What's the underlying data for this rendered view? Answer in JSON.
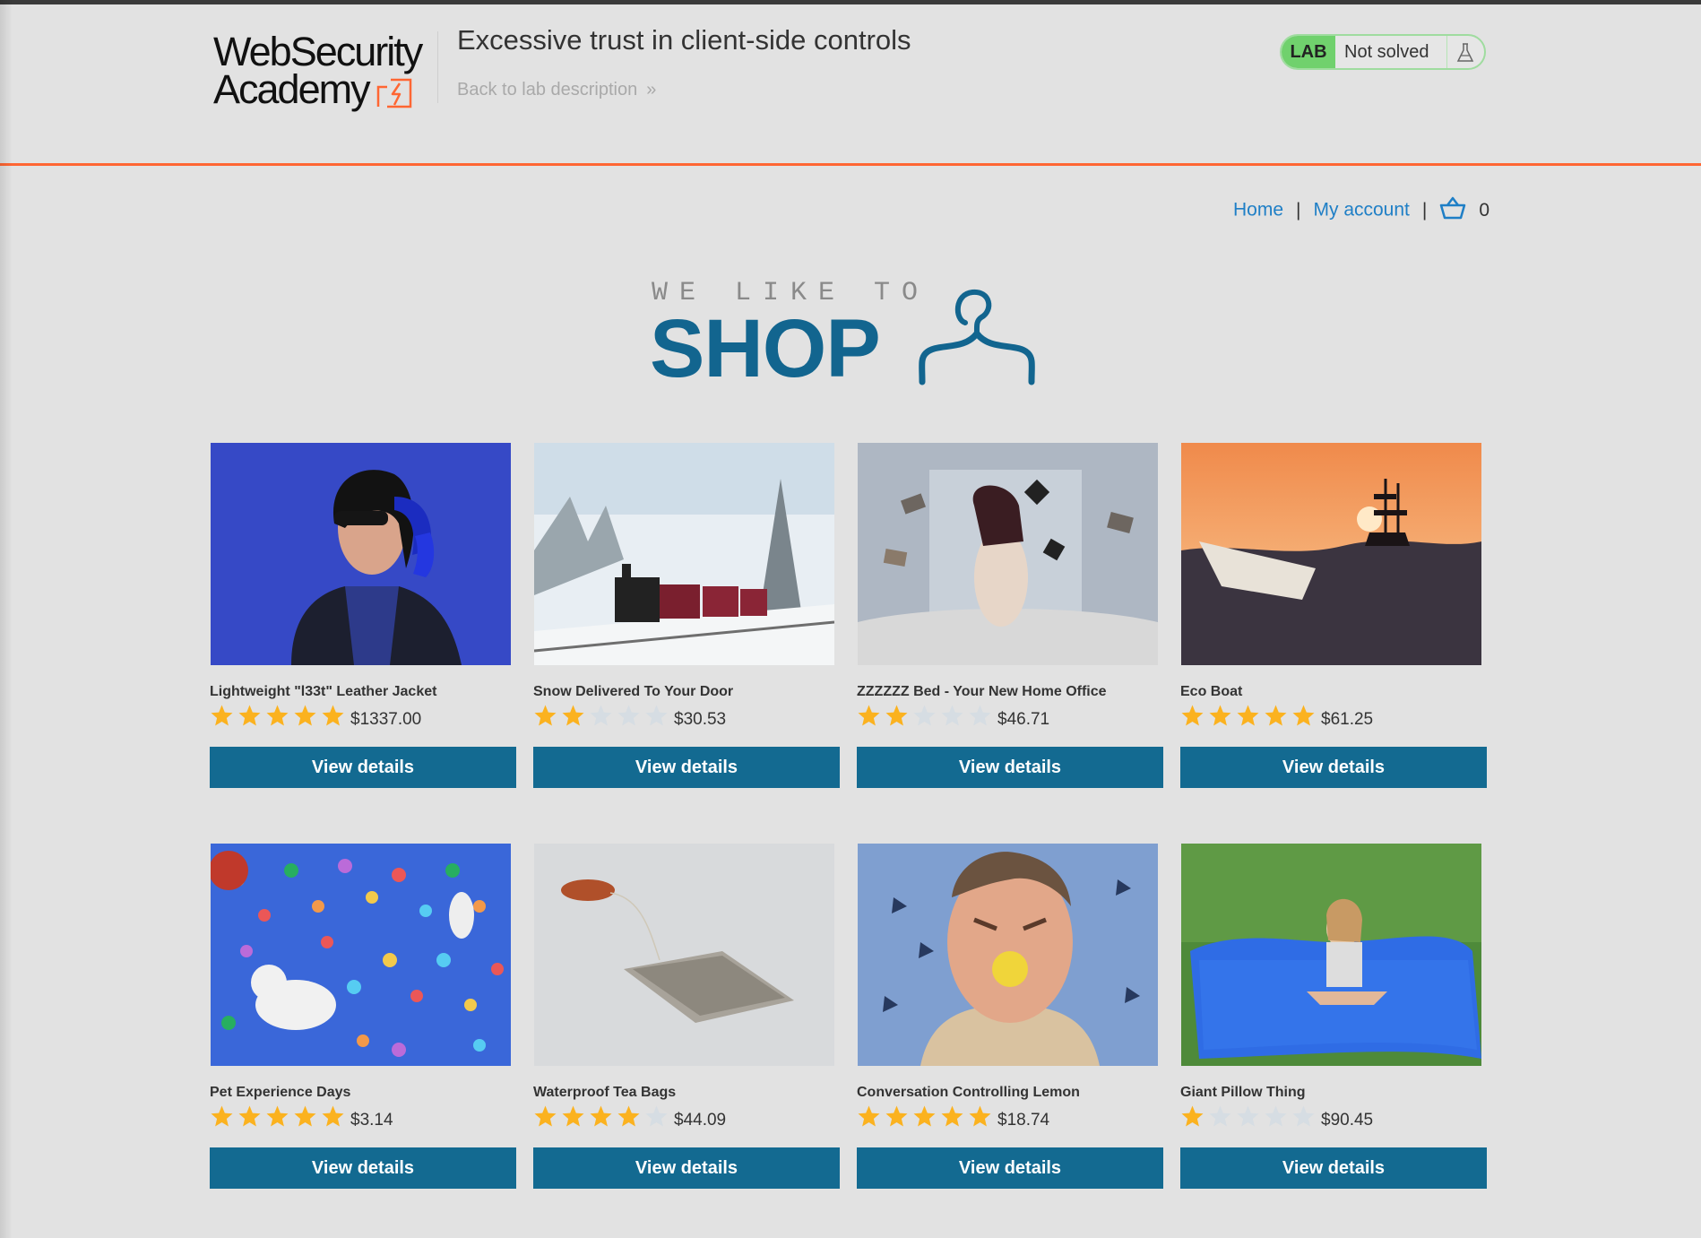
{
  "header": {
    "logo_line1": "WebSecurity",
    "logo_line2": "Academy",
    "lab_title": "Excessive trust in client-side controls",
    "back_link": "Back to lab description",
    "back_chevron": "»",
    "lab_tag": "LAB",
    "lab_status": "Not solved",
    "accent_color": "#ff6633",
    "status_color": "#70d16d"
  },
  "nav": {
    "home": "Home",
    "separator": "|",
    "account": "My account",
    "cart_icon": "cart-icon",
    "cart_count": "0"
  },
  "banner": {
    "small_text": "WE LIKE TO",
    "big_text": "SHOP",
    "brand_color": "#12658f"
  },
  "products": [
    {
      "name": "Lightweight \"l33t\" Leather Jacket",
      "rating": 5,
      "price": "$1337.00",
      "button": "View details"
    },
    {
      "name": "Snow Delivered To Your Door",
      "rating": 2,
      "price": "$30.53",
      "button": "View details"
    },
    {
      "name": "ZZZZZZ Bed - Your New Home Office",
      "rating": 2,
      "price": "$46.71",
      "button": "View details"
    },
    {
      "name": "Eco Boat",
      "rating": 5,
      "price": "$61.25",
      "button": "View details"
    },
    {
      "name": "Pet Experience Days",
      "rating": 5,
      "price": "$3.14",
      "button": "View details"
    },
    {
      "name": "Waterproof Tea Bags",
      "rating": 4,
      "price": "$44.09",
      "button": "View details"
    },
    {
      "name": "Conversation Controlling Lemon",
      "rating": 5,
      "price": "$18.74",
      "button": "View details"
    },
    {
      "name": "Giant Pillow Thing",
      "rating": 1,
      "price": "$90.45",
      "button": "View details"
    }
  ]
}
